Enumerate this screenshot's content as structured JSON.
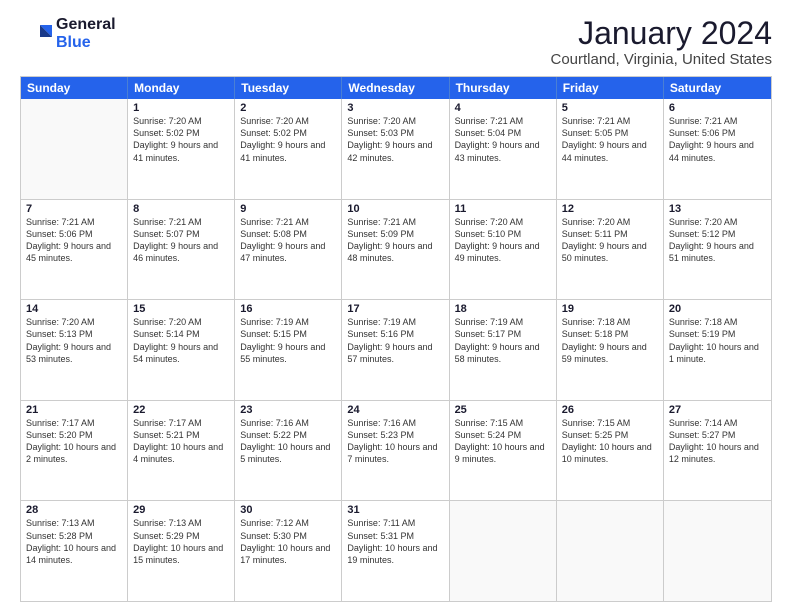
{
  "logo": {
    "line1": "General",
    "line2": "Blue"
  },
  "title": "January 2024",
  "subtitle": "Courtland, Virginia, United States",
  "header_days": [
    "Sunday",
    "Monday",
    "Tuesday",
    "Wednesday",
    "Thursday",
    "Friday",
    "Saturday"
  ],
  "weeks": [
    [
      {
        "num": "",
        "sunrise": "",
        "sunset": "",
        "daylight": ""
      },
      {
        "num": "1",
        "sunrise": "Sunrise: 7:20 AM",
        "sunset": "Sunset: 5:02 PM",
        "daylight": "Daylight: 9 hours and 41 minutes."
      },
      {
        "num": "2",
        "sunrise": "Sunrise: 7:20 AM",
        "sunset": "Sunset: 5:02 PM",
        "daylight": "Daylight: 9 hours and 41 minutes."
      },
      {
        "num": "3",
        "sunrise": "Sunrise: 7:20 AM",
        "sunset": "Sunset: 5:03 PM",
        "daylight": "Daylight: 9 hours and 42 minutes."
      },
      {
        "num": "4",
        "sunrise": "Sunrise: 7:21 AM",
        "sunset": "Sunset: 5:04 PM",
        "daylight": "Daylight: 9 hours and 43 minutes."
      },
      {
        "num": "5",
        "sunrise": "Sunrise: 7:21 AM",
        "sunset": "Sunset: 5:05 PM",
        "daylight": "Daylight: 9 hours and 44 minutes."
      },
      {
        "num": "6",
        "sunrise": "Sunrise: 7:21 AM",
        "sunset": "Sunset: 5:06 PM",
        "daylight": "Daylight: 9 hours and 44 minutes."
      }
    ],
    [
      {
        "num": "7",
        "sunrise": "Sunrise: 7:21 AM",
        "sunset": "Sunset: 5:06 PM",
        "daylight": "Daylight: 9 hours and 45 minutes."
      },
      {
        "num": "8",
        "sunrise": "Sunrise: 7:21 AM",
        "sunset": "Sunset: 5:07 PM",
        "daylight": "Daylight: 9 hours and 46 minutes."
      },
      {
        "num": "9",
        "sunrise": "Sunrise: 7:21 AM",
        "sunset": "Sunset: 5:08 PM",
        "daylight": "Daylight: 9 hours and 47 minutes."
      },
      {
        "num": "10",
        "sunrise": "Sunrise: 7:21 AM",
        "sunset": "Sunset: 5:09 PM",
        "daylight": "Daylight: 9 hours and 48 minutes."
      },
      {
        "num": "11",
        "sunrise": "Sunrise: 7:20 AM",
        "sunset": "Sunset: 5:10 PM",
        "daylight": "Daylight: 9 hours and 49 minutes."
      },
      {
        "num": "12",
        "sunrise": "Sunrise: 7:20 AM",
        "sunset": "Sunset: 5:11 PM",
        "daylight": "Daylight: 9 hours and 50 minutes."
      },
      {
        "num": "13",
        "sunrise": "Sunrise: 7:20 AM",
        "sunset": "Sunset: 5:12 PM",
        "daylight": "Daylight: 9 hours and 51 minutes."
      }
    ],
    [
      {
        "num": "14",
        "sunrise": "Sunrise: 7:20 AM",
        "sunset": "Sunset: 5:13 PM",
        "daylight": "Daylight: 9 hours and 53 minutes."
      },
      {
        "num": "15",
        "sunrise": "Sunrise: 7:20 AM",
        "sunset": "Sunset: 5:14 PM",
        "daylight": "Daylight: 9 hours and 54 minutes."
      },
      {
        "num": "16",
        "sunrise": "Sunrise: 7:19 AM",
        "sunset": "Sunset: 5:15 PM",
        "daylight": "Daylight: 9 hours and 55 minutes."
      },
      {
        "num": "17",
        "sunrise": "Sunrise: 7:19 AM",
        "sunset": "Sunset: 5:16 PM",
        "daylight": "Daylight: 9 hours and 57 minutes."
      },
      {
        "num": "18",
        "sunrise": "Sunrise: 7:19 AM",
        "sunset": "Sunset: 5:17 PM",
        "daylight": "Daylight: 9 hours and 58 minutes."
      },
      {
        "num": "19",
        "sunrise": "Sunrise: 7:18 AM",
        "sunset": "Sunset: 5:18 PM",
        "daylight": "Daylight: 9 hours and 59 minutes."
      },
      {
        "num": "20",
        "sunrise": "Sunrise: 7:18 AM",
        "sunset": "Sunset: 5:19 PM",
        "daylight": "Daylight: 10 hours and 1 minute."
      }
    ],
    [
      {
        "num": "21",
        "sunrise": "Sunrise: 7:17 AM",
        "sunset": "Sunset: 5:20 PM",
        "daylight": "Daylight: 10 hours and 2 minutes."
      },
      {
        "num": "22",
        "sunrise": "Sunrise: 7:17 AM",
        "sunset": "Sunset: 5:21 PM",
        "daylight": "Daylight: 10 hours and 4 minutes."
      },
      {
        "num": "23",
        "sunrise": "Sunrise: 7:16 AM",
        "sunset": "Sunset: 5:22 PM",
        "daylight": "Daylight: 10 hours and 5 minutes."
      },
      {
        "num": "24",
        "sunrise": "Sunrise: 7:16 AM",
        "sunset": "Sunset: 5:23 PM",
        "daylight": "Daylight: 10 hours and 7 minutes."
      },
      {
        "num": "25",
        "sunrise": "Sunrise: 7:15 AM",
        "sunset": "Sunset: 5:24 PM",
        "daylight": "Daylight: 10 hours and 9 minutes."
      },
      {
        "num": "26",
        "sunrise": "Sunrise: 7:15 AM",
        "sunset": "Sunset: 5:25 PM",
        "daylight": "Daylight: 10 hours and 10 minutes."
      },
      {
        "num": "27",
        "sunrise": "Sunrise: 7:14 AM",
        "sunset": "Sunset: 5:27 PM",
        "daylight": "Daylight: 10 hours and 12 minutes."
      }
    ],
    [
      {
        "num": "28",
        "sunrise": "Sunrise: 7:13 AM",
        "sunset": "Sunset: 5:28 PM",
        "daylight": "Daylight: 10 hours and 14 minutes."
      },
      {
        "num": "29",
        "sunrise": "Sunrise: 7:13 AM",
        "sunset": "Sunset: 5:29 PM",
        "daylight": "Daylight: 10 hours and 15 minutes."
      },
      {
        "num": "30",
        "sunrise": "Sunrise: 7:12 AM",
        "sunset": "Sunset: 5:30 PM",
        "daylight": "Daylight: 10 hours and 17 minutes."
      },
      {
        "num": "31",
        "sunrise": "Sunrise: 7:11 AM",
        "sunset": "Sunset: 5:31 PM",
        "daylight": "Daylight: 10 hours and 19 minutes."
      },
      {
        "num": "",
        "sunrise": "",
        "sunset": "",
        "daylight": ""
      },
      {
        "num": "",
        "sunrise": "",
        "sunset": "",
        "daylight": ""
      },
      {
        "num": "",
        "sunrise": "",
        "sunset": "",
        "daylight": ""
      }
    ]
  ]
}
